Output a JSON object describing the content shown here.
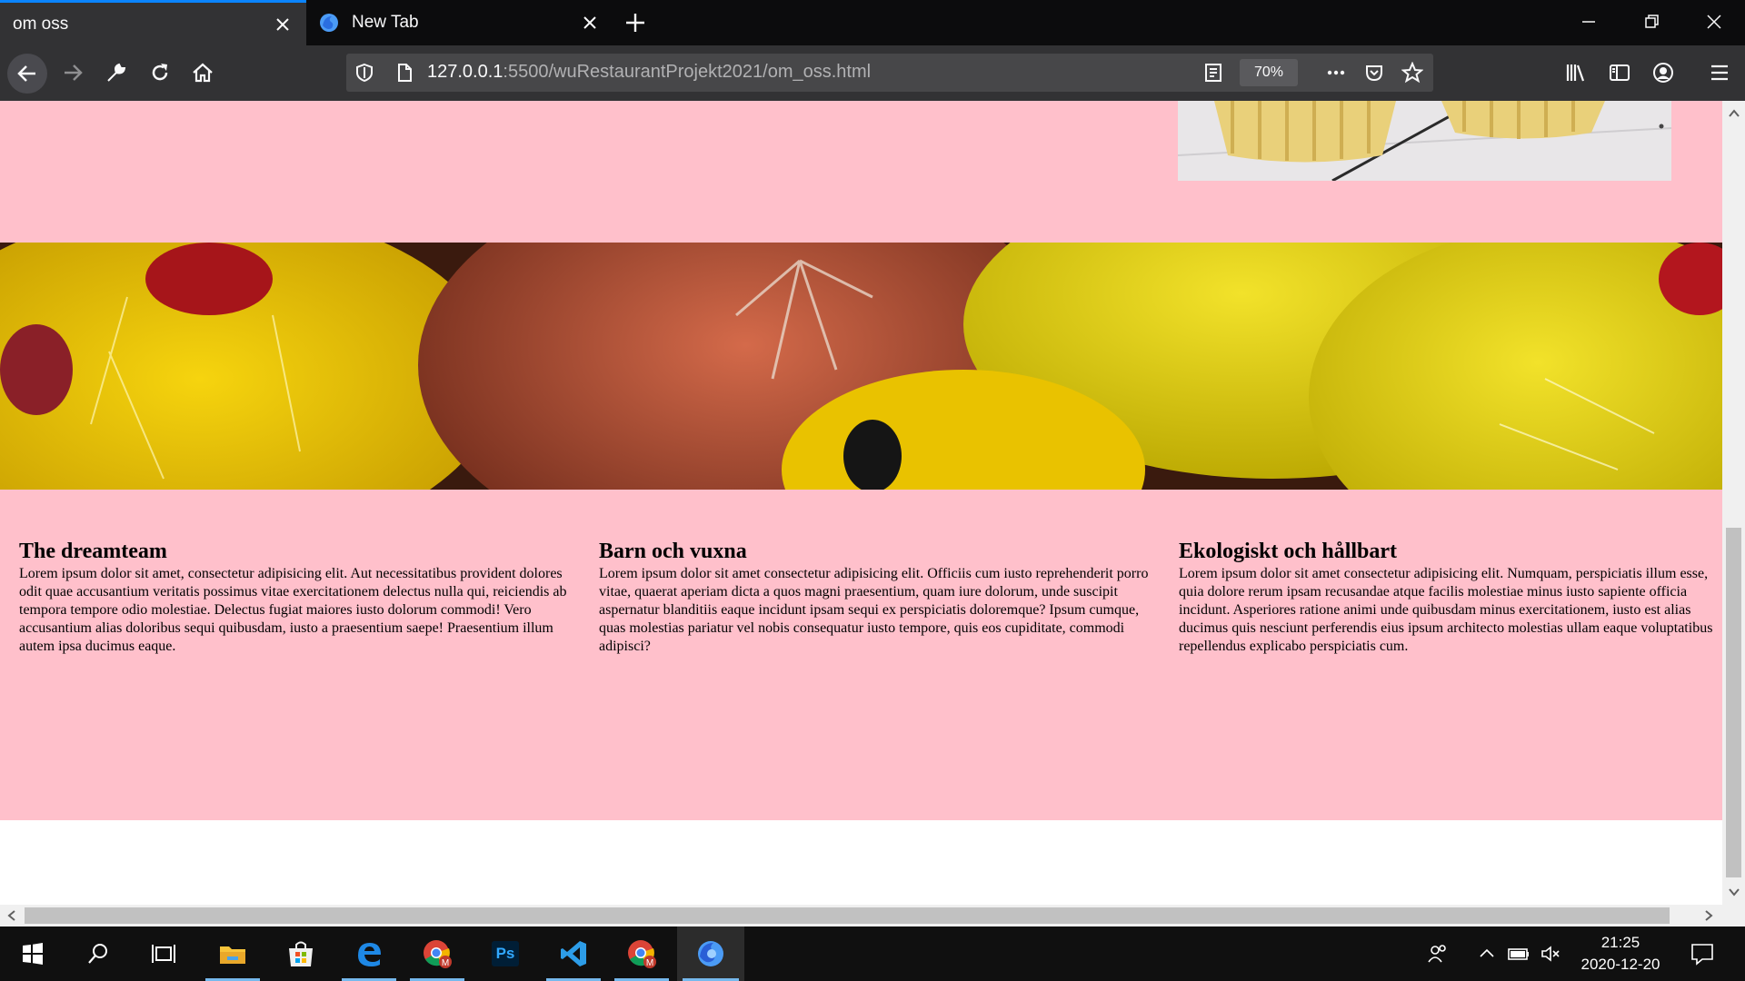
{
  "browser": {
    "tabs": [
      {
        "title": "om oss",
        "active": true
      },
      {
        "title": "New Tab",
        "active": false
      }
    ],
    "url": {
      "host": "127.0.0.1",
      "path": ":5500/wuRestaurantProjekt2021/om_oss.html"
    },
    "zoom": "70%"
  },
  "page": {
    "background_color": "#ffc0cb",
    "columns": [
      {
        "heading": "The dreamteam",
        "body": "Lorem ipsum dolor sit amet, consectetur adipisicing elit. Aut necessitatibus provident dolores odit quae accusantium veritatis possimus vitae exercitationem delectus nulla qui, reiciendis ab tempora tempore odio molestiae. Delectus fugiat maiores iusto dolorum commodi! Vero accusantium alias doloribus sequi quibusdam, iusto a praesentium saepe! Praesentium illum autem ipsa ducimus eaque."
      },
      {
        "heading": "Barn och vuxna",
        "body": "Lorem ipsum dolor sit amet consectetur adipisicing elit. Officiis cum iusto reprehenderit porro vitae, quaerat aperiam dicta a quos magni praesentium, quam iure dolorum, unde suscipit aspernatur blanditiis eaque incidunt ipsam sequi ex perspiciatis doloremque? Ipsum cumque, quas molestias pariatur vel nobis consequatur iusto tempore, quis eos cupiditate, commodi adipisci?"
      },
      {
        "heading": "Ekologiskt och hållbart",
        "body": "Lorem ipsum dolor sit amet consectetur adipisicing elit. Numquam, perspiciatis illum esse, quia dolore rerum ipsam recusandae atque facilis molestiae minus iusto sapiente officia incidunt. Asperiores ratione animi unde quibusdam minus exercitationem, iusto est alias ducimus quis nesciunt perferendis eius ipsum architecto molestias ullam eaque voluptatibus repellendus explicabo perspiciatis cum."
      }
    ]
  },
  "taskbar": {
    "apps": [
      "start-icon",
      "search-icon",
      "task-view-icon",
      "file-explorer-icon",
      "store-icon",
      "edge-icon",
      "chrome-icon",
      "photoshop-icon",
      "vscode-icon",
      "chrome-profile-icon",
      "firefox-icon"
    ],
    "photoshop_label": "Ps",
    "time": "21:25",
    "date": "2020-12-20"
  }
}
